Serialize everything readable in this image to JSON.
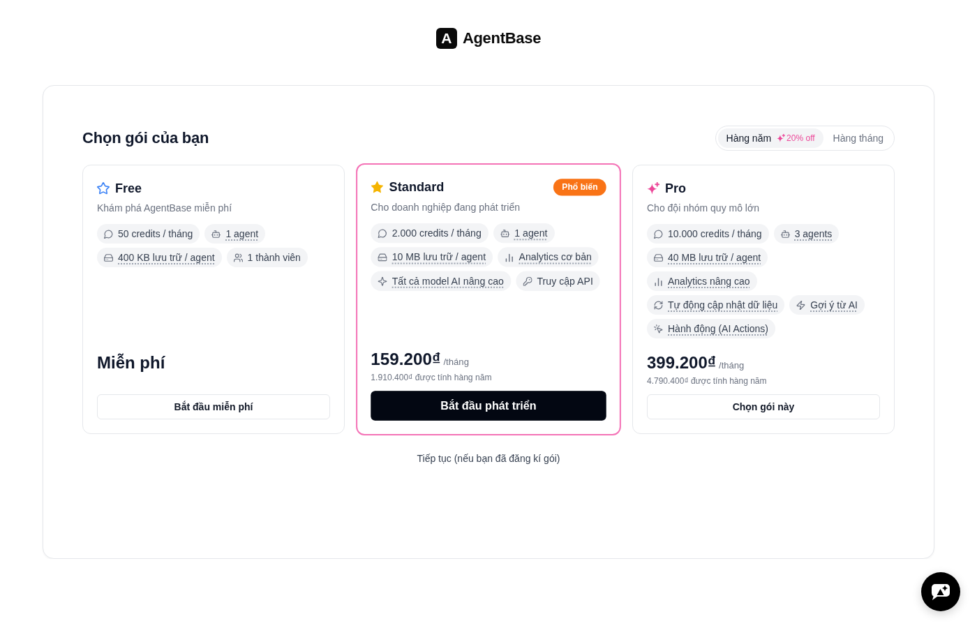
{
  "brand": {
    "mark": "A",
    "name": "AgentBase"
  },
  "heading": "Chọn gói của bạn",
  "billing_toggle": [
    {
      "label": "Hàng năm",
      "discount": "20% off",
      "selected": true
    },
    {
      "label": "Hàng tháng",
      "selected": false
    }
  ],
  "plans": [
    {
      "name": "Free",
      "kind": "star-outline",
      "color": "#3b82f6",
      "featured": false,
      "description": "Khám phá AgentBase miễn phí",
      "features": [
        {
          "kind": "chat",
          "text": "50 credits / tháng",
          "underlined": false
        },
        {
          "kind": "bot",
          "text": "1 agent",
          "underlined": true
        },
        {
          "kind": "storage",
          "text": "400 KB lưu trữ / agent",
          "underlined": true
        },
        {
          "kind": "users",
          "text": "1 thành viên",
          "underlined": false
        }
      ],
      "price": "Miễn phí",
      "button": {
        "label": "Bắt đầu miễn phí",
        "primary": false
      }
    },
    {
      "name": "Standard",
      "kind": "star-filled",
      "color": "#f5b400",
      "featured": true,
      "badge": "Phổ biến",
      "description": "Cho doanh nghiệp đang phát triển",
      "features": [
        {
          "kind": "chat",
          "text": "2.000 credits / tháng",
          "underlined": false
        },
        {
          "kind": "bot",
          "text": "1 agent",
          "underlined": true
        },
        {
          "kind": "storage",
          "text": "10 MB lưu trữ / agent",
          "underlined": true
        },
        {
          "kind": "chart",
          "text": "Analytics cơ bản",
          "underlined": true
        },
        {
          "kind": "sparkle",
          "text": "Tất cả model AI nâng cao",
          "underlined": true
        },
        {
          "kind": "key",
          "text": "Truy cập API",
          "underlined": false
        }
      ],
      "price": "159.200₫",
      "period": "/tháng",
      "note": "1.910.400₫ được tính hàng năm",
      "button": {
        "label": "Bắt đầu phát triển",
        "primary": true
      }
    },
    {
      "name": "Pro",
      "kind": "sparkles",
      "color": "#ec4899",
      "featured": false,
      "description": "Cho đội nhóm quy mô lớn",
      "features": [
        {
          "kind": "chat",
          "text": "10.000 credits / tháng",
          "underlined": false
        },
        {
          "kind": "bot",
          "text": "3 agents",
          "underlined": true
        },
        {
          "kind": "storage",
          "text": "40 MB lưu trữ / agent",
          "underlined": true
        },
        {
          "kind": "chart",
          "text": "Analytics nâng cao",
          "underlined": true
        },
        {
          "kind": "refresh",
          "text": "Tự động cập nhật dữ liệu",
          "underlined": true
        },
        {
          "kind": "zap",
          "text": "Gợi ý từ AI",
          "underlined": true
        },
        {
          "kind": "cursor",
          "text": "Hành động (AI Actions)",
          "underlined": true
        }
      ],
      "price": "399.200₫",
      "period": "/tháng",
      "note": "4.790.400₫ được tính hàng năm",
      "button": {
        "label": "Chọn gói này",
        "primary": false
      }
    }
  ],
  "continue_link": "Tiếp tục (nếu bạn đã đăng kí gói)"
}
